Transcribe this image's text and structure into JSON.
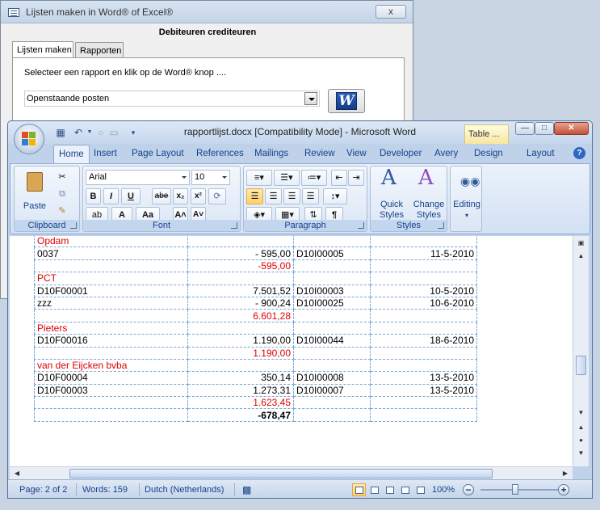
{
  "dialog": {
    "title": "Lijsten maken in Word® of Excel®",
    "close_label": "x",
    "heading": "Debiteuren crediteuren",
    "tabs": [
      {
        "label": "Lijsten maken"
      },
      {
        "label": "Rapporten"
      }
    ],
    "instruction": "Selecteer een rapport en klik op de Word® knop ....",
    "report_select": {
      "value": "Openstaande posten"
    },
    "word_button_label": "W"
  },
  "word": {
    "title": "rapportlijst.docx [Compatibility Mode] - Microsoft Word",
    "context_tab": "Table ...",
    "ribbon_tabs": [
      {
        "label": "Home"
      },
      {
        "label": "Insert"
      },
      {
        "label": "Page Layout"
      },
      {
        "label": "References"
      },
      {
        "label": "Mailings"
      },
      {
        "label": "Review"
      },
      {
        "label": "View"
      },
      {
        "label": "Developer"
      },
      {
        "label": "Avery"
      },
      {
        "label": "Design"
      },
      {
        "label": "Layout"
      }
    ],
    "help_label": "?",
    "groups": {
      "clipboard": {
        "label": "Clipboard",
        "paste": "Paste"
      },
      "font": {
        "label": "Font",
        "family": "Arial",
        "size": "10",
        "bold": "B",
        "italic": "I",
        "underline": "U",
        "strike": "abe",
        "subscript": "x₂",
        "superscript": "x²",
        "grow": "A˄",
        "shrink": "A˅",
        "case": "Aa"
      },
      "paragraph": {
        "label": "Paragraph",
        "pilcrow": "¶"
      },
      "styles": {
        "label": "Styles",
        "quick": "Quick",
        "quick2": "Styles",
        "change": "Change",
        "change2": "Styles"
      },
      "editing": {
        "label": "Editing"
      }
    },
    "table_rows": [
      {
        "c1": "Opdam",
        "c2": "",
        "c3": "",
        "c4": "",
        "type": "header"
      },
      {
        "c1": "0037",
        "c2": "-  595,00",
        "c3": "D10I00005",
        "c4": "11-5-2010",
        "type": "row"
      },
      {
        "c1": "",
        "c2": "-595,00",
        "c3": "",
        "c4": "",
        "type": "subtotal"
      },
      {
        "c1": "PCT",
        "c2": "",
        "c3": "",
        "c4": "",
        "type": "header"
      },
      {
        "c1": "D10F00001",
        "c2": "7.501,52",
        "c3": "D10I00003",
        "c4": "10-5-2010",
        "type": "row"
      },
      {
        "c1": "zzz",
        "c2": "-  900,24",
        "c3": "D10I00025",
        "c4": "10-6-2010",
        "type": "row"
      },
      {
        "c1": "",
        "c2": "6.601,28",
        "c3": "",
        "c4": "",
        "type": "subtotal"
      },
      {
        "c1": "Pieters",
        "c2": "",
        "c3": "",
        "c4": "",
        "type": "header"
      },
      {
        "c1": "D10F00016",
        "c2": "1.190,00",
        "c3": "D10I00044",
        "c4": "18-6-2010",
        "type": "row"
      },
      {
        "c1": "",
        "c2": "1.190,00",
        "c3": "",
        "c4": "",
        "type": "subtotal"
      },
      {
        "c1": "van der Eijcken bvba",
        "c2": "",
        "c3": "",
        "c4": "",
        "type": "header"
      },
      {
        "c1": "D10F00004",
        "c2": "350,14",
        "c3": "D10I00008",
        "c4": "13-5-2010",
        "type": "row"
      },
      {
        "c1": "D10F00003",
        "c2": "1.273,31",
        "c3": "D10I00007",
        "c4": "13-5-2010",
        "type": "row"
      },
      {
        "c1": "",
        "c2": "1.623,45",
        "c3": "",
        "c4": "",
        "type": "subtotal"
      },
      {
        "c1": "",
        "c2": "-678,47",
        "c3": "",
        "c4": "",
        "type": "total"
      }
    ],
    "status": {
      "page": "Page: 2 of 2",
      "words": "Words: 159",
      "language": "Dutch (Netherlands)",
      "zoom": "100%"
    },
    "colors": {
      "subtotal": "#e00000",
      "header": "#e00000",
      "grid": "#7aa6d9"
    }
  }
}
